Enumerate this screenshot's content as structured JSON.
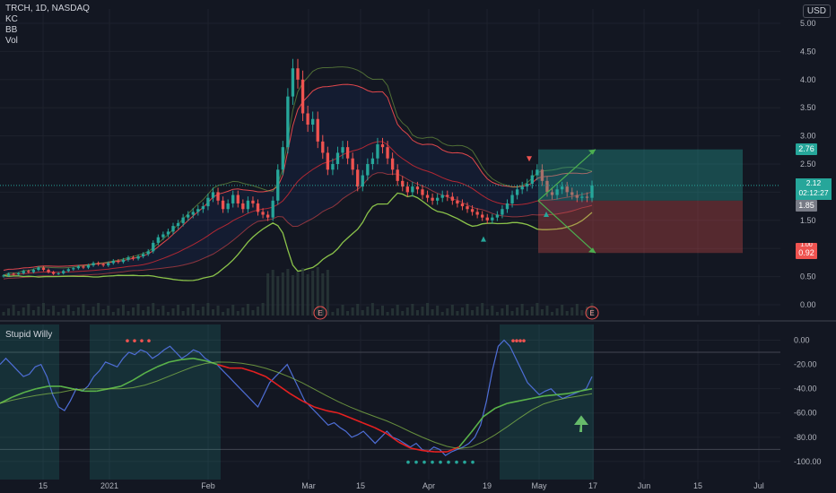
{
  "header": {
    "symbol_line": "TRCH, 1D, NASDAQ",
    "indicators": [
      "KC",
      "BB",
      "Vol"
    ],
    "currency": "USD"
  },
  "oscillator": {
    "title": "Stupid Willy"
  },
  "price_tags": {
    "target": "2.76",
    "last": "2.12",
    "countdown": "02:12:27",
    "prev": "1.85",
    "stop_label": "1.00",
    "stop": "0.92"
  },
  "earnings_marker": "E",
  "colors": {
    "background": "#131722",
    "bull": "#26a69a",
    "bear": "#ef5350",
    "keltner": "#e0474c",
    "bollinger": "#8bc34a",
    "willy": "#4e6ed6",
    "willy_ma": "#5ab34a",
    "willy_ma_down": "#e52020",
    "highlight": "#26a69a"
  },
  "chart_data": [
    {
      "type": "candlestick",
      "title": "TRCH, 1D, NASDAQ",
      "ylabel": "USD",
      "ylim": [
        -0.1,
        5.25
      ],
      "y_ticks": [
        0.0,
        0.5,
        1.0,
        1.5,
        2.0,
        2.5,
        3.0,
        3.5,
        4.0,
        4.5,
        5.0
      ],
      "y_tick_labels": [
        "0.00",
        "0.50",
        "1.00",
        "1.50",
        "2.00",
        "2.50",
        "3.00",
        "3.50",
        "4.00",
        "4.50",
        "5.00"
      ],
      "x_ticks": [
        "15",
        "2021",
        "Feb",
        "Mar",
        "15",
        "Apr",
        "19",
        "May",
        "17",
        "Jun",
        "15",
        "Jul"
      ],
      "grid": true,
      "close_series": [
        0.52,
        0.55,
        0.54,
        0.56,
        0.6,
        0.58,
        0.62,
        0.66,
        0.62,
        0.58,
        0.55,
        0.56,
        0.6,
        0.63,
        0.65,
        0.68,
        0.66,
        0.7,
        0.74,
        0.72,
        0.7,
        0.74,
        0.78,
        0.76,
        0.8,
        0.84,
        0.82,
        0.86,
        0.9,
        0.95,
        1.1,
        1.2,
        1.25,
        1.3,
        1.4,
        1.45,
        1.55,
        1.6,
        1.65,
        1.7,
        1.75,
        1.9,
        2.0,
        1.85,
        1.7,
        1.8,
        1.95,
        1.8,
        1.7,
        1.85,
        1.8,
        1.65,
        1.6,
        1.55,
        1.85,
        2.4,
        2.8,
        3.7,
        4.2,
        4.0,
        3.4,
        3.2,
        3.3,
        2.9,
        2.7,
        2.4,
        2.5,
        2.7,
        2.8,
        2.6,
        2.4,
        2.1,
        2.3,
        2.5,
        2.6,
        2.85,
        2.8,
        2.6,
        2.4,
        2.2,
        2.1,
        2.0,
        2.1,
        2.05,
        1.95,
        1.9,
        1.85,
        1.9,
        1.95,
        1.92,
        1.85,
        1.8,
        1.75,
        1.7,
        1.65,
        1.6,
        1.55,
        1.5,
        1.55,
        1.6,
        1.7,
        1.8,
        1.95,
        2.05,
        2.1,
        2.15,
        2.3,
        2.4,
        2.2,
        2.0,
        1.95,
        2.05,
        2.1,
        2.0,
        1.95,
        1.9,
        1.92,
        1.9,
        2.12
      ],
      "event_markers": [
        {
          "label": "E",
          "x": "Mar"
        },
        {
          "label": "E",
          "x": "May 17"
        }
      ],
      "risk_reward": {
        "entry": 1.85,
        "target": 2.76,
        "stop": 0.92
      },
      "volume": {
        "note": "Volume histogram shown faintly along bottom of price pane"
      }
    },
    {
      "type": "line",
      "title": "Stupid Willy",
      "ylim": [
        -105,
        5
      ],
      "y_ticks": [
        0,
        -20,
        -40,
        -60,
        -80,
        -100
      ],
      "y_tick_labels": [
        "0.00",
        "-20.00",
        "-40.00",
        "-60.00",
        "-80.00",
        "-100.00"
      ],
      "hlines": [
        -10,
        -90
      ],
      "x_ticks": [
        "15",
        "2021",
        "Feb",
        "Mar",
        "15",
        "Apr",
        "19",
        "May",
        "17",
        "Jun",
        "15",
        "Jul"
      ],
      "series": [
        {
          "values": [
            -20,
            -15,
            -20,
            -25,
            -30,
            -28,
            -22,
            -20,
            -30,
            -45,
            -55,
            -58,
            -50,
            -40,
            -42,
            -38,
            -30,
            -25,
            -18,
            -20,
            -22,
            -15,
            -10,
            -12,
            -8,
            -10,
            -15,
            -12,
            -8,
            -5,
            -10,
            -15,
            -12,
            -8,
            -10,
            -15,
            -18,
            -20,
            -25,
            -30,
            -35,
            -40,
            -45,
            -50,
            -55,
            -45,
            -35,
            -30,
            -25,
            -20,
            -30,
            -40,
            -50,
            -55,
            -60,
            -65,
            -70,
            -68,
            -72,
            -75,
            -80,
            -78,
            -75,
            -80,
            -85,
            -80,
            -75,
            -80,
            -82,
            -85,
            -88,
            -85,
            -90,
            -92,
            -88,
            -90,
            -95,
            -92,
            -90,
            -88,
            -85,
            -80,
            -70,
            -50,
            -25,
            -5,
            0,
            -5,
            -15,
            -25,
            -35,
            -40,
            -45,
            -42,
            -40,
            -45,
            -48,
            -46,
            -44,
            -42,
            -40,
            -30
          ]
        },
        {
          "values": [
            -52,
            -47,
            -43,
            -40,
            -38,
            -38,
            -40,
            -42,
            -42,
            -40,
            -38,
            -33,
            -27,
            -22,
            -18,
            -16,
            -15,
            -17,
            -20,
            -23,
            -23,
            -26,
            -30,
            -37,
            -44,
            -50,
            -55,
            -58,
            -60,
            -64,
            -68,
            -72,
            -77,
            -84,
            -89,
            -91,
            -92,
            -92,
            -88,
            -76,
            -63,
            -56,
            -52,
            -50,
            -48,
            -46,
            -45,
            -44,
            -42,
            -40
          ]
        }
      ],
      "signal_dots_top": 8,
      "signal_dots_bottom": 9,
      "highlight_zones": [
        {
          "from": "Jan (early)",
          "to": "Feb (early)"
        },
        {
          "from": "Apr 19",
          "to": "May 17"
        }
      ]
    }
  ]
}
